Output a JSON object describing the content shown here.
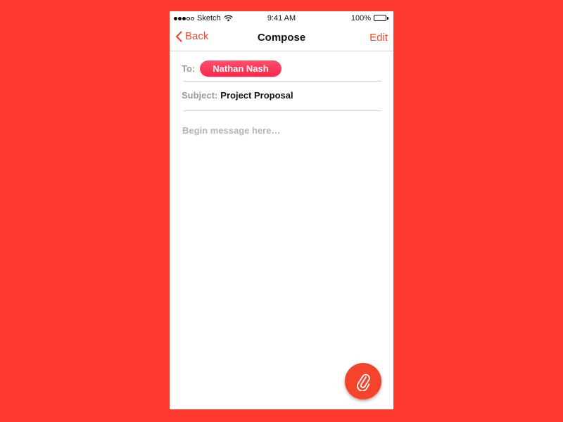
{
  "status_bar": {
    "carrier": "Sketch",
    "time": "9:41 AM",
    "battery": "100%"
  },
  "nav": {
    "back_label": "Back",
    "title": "Compose",
    "edit_label": "Edit"
  },
  "compose": {
    "to_label": "To:",
    "recipient": "Nathan Nash",
    "subject_label": "Subject:",
    "subject_value": "Project Proposal",
    "message_value": "",
    "message_placeholder": "Begin message here…"
  },
  "icons": {
    "back": "chevron-left-icon",
    "attach": "paperclip-icon",
    "wifi": "wifi-icon",
    "battery": "battery-icon"
  },
  "colors": {
    "background": "#fd3a2d",
    "accent": "#f04a2c",
    "chip": "#f7284d",
    "fab": "#f4452c"
  }
}
